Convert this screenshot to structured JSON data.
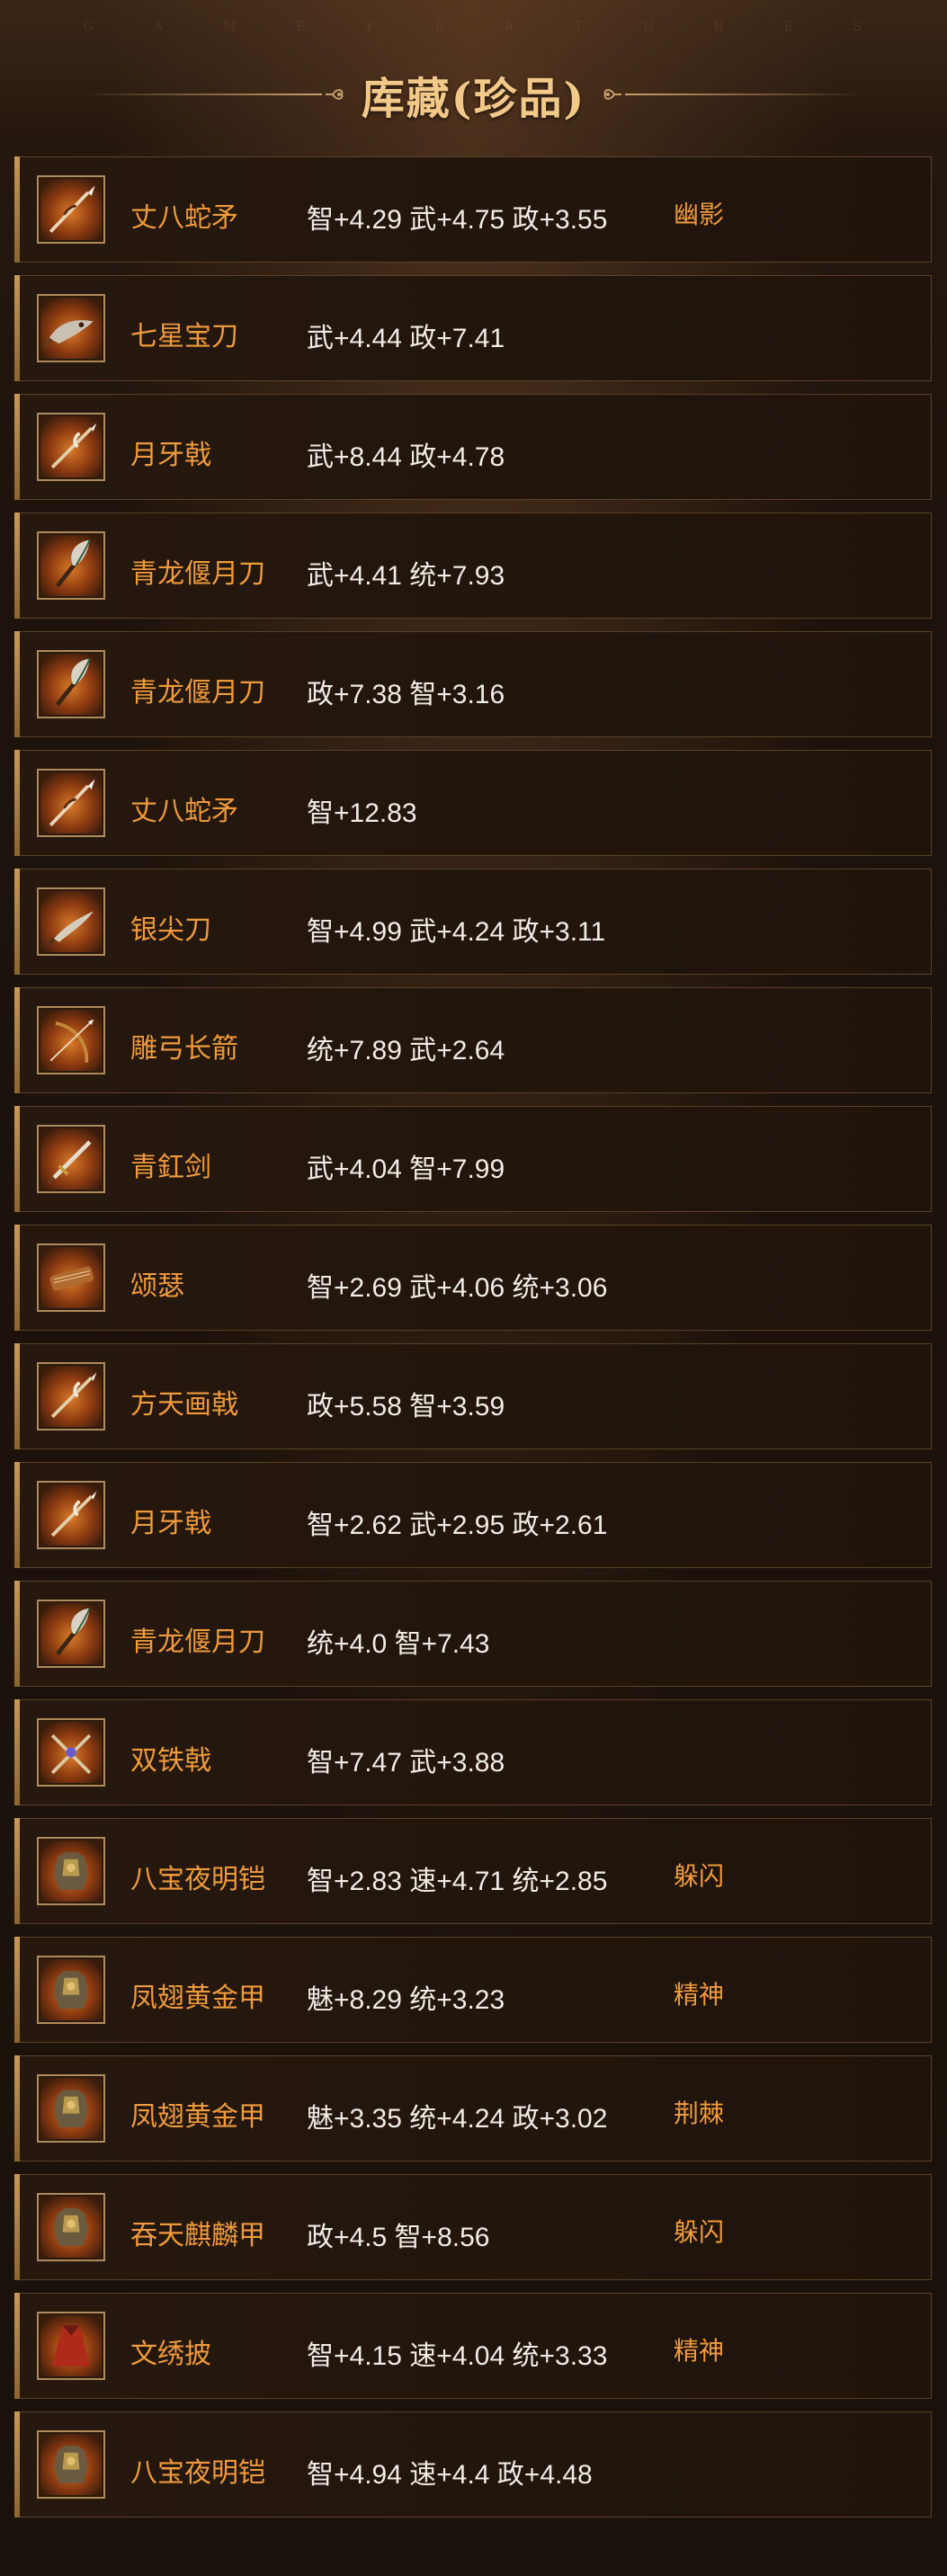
{
  "header": {
    "bg_letters": [
      "G",
      "A",
      "M",
      "E",
      "F",
      "E",
      "A",
      "T",
      "U",
      "R",
      "E",
      "S"
    ],
    "title": "库藏(珍品)"
  },
  "colors": {
    "name": "#ef9a3c",
    "stats": "#f1ece4",
    "title": "#f3c98a",
    "frame": "#b08a5a"
  },
  "items": [
    {
      "name": "丈八蛇矛",
      "stats": "智+4.29 武+4.75 政+3.55",
      "skill": "幽影",
      "icon": "spear-icon"
    },
    {
      "name": "七星宝刀",
      "stats": "武+4.44 政+7.41",
      "skill": "",
      "icon": "dragon-blade-icon"
    },
    {
      "name": "月牙戟",
      "stats": "武+8.44 政+4.78",
      "skill": "",
      "icon": "halberd-icon"
    },
    {
      "name": "青龙偃月刀",
      "stats": "武+4.41 统+7.93",
      "skill": "",
      "icon": "glaive-icon"
    },
    {
      "name": "青龙偃月刀",
      "stats": "政+7.38 智+3.16",
      "skill": "",
      "icon": "glaive-icon"
    },
    {
      "name": "丈八蛇矛",
      "stats": "智+12.83",
      "skill": "",
      "icon": "spear-icon"
    },
    {
      "name": "银尖刀",
      "stats": "智+4.99 武+4.24 政+3.11",
      "skill": "",
      "icon": "blade-icon"
    },
    {
      "name": "雕弓长箭",
      "stats": "统+7.89 武+2.64",
      "skill": "",
      "icon": "bow-icon"
    },
    {
      "name": "青釭剑",
      "stats": "武+4.04 智+7.99",
      "skill": "",
      "icon": "sword-icon"
    },
    {
      "name": "颂瑟",
      "stats": "智+2.69 武+4.06 统+3.06",
      "skill": "",
      "icon": "zither-icon"
    },
    {
      "name": "方天画戟",
      "stats": "政+5.58 智+3.59",
      "skill": "",
      "icon": "halberd-icon"
    },
    {
      "name": "月牙戟",
      "stats": "智+2.62 武+2.95 政+2.61",
      "skill": "",
      "icon": "halberd-icon"
    },
    {
      "name": "青龙偃月刀",
      "stats": "统+4.0 智+7.43",
      "skill": "",
      "icon": "glaive-icon"
    },
    {
      "name": "双铁戟",
      "stats": "智+7.47 武+3.88",
      "skill": "",
      "icon": "twin-halberd-icon"
    },
    {
      "name": "八宝夜明铠",
      "stats": "智+2.83 速+4.71 统+2.85",
      "skill": "躲闪",
      "icon": "armor-icon"
    },
    {
      "name": "凤翅黄金甲",
      "stats": "魅+8.29 统+3.23",
      "skill": "精神",
      "icon": "armor-icon"
    },
    {
      "name": "凤翅黄金甲",
      "stats": "魅+3.35 统+4.24 政+3.02",
      "skill": "荆棘",
      "icon": "armor-icon"
    },
    {
      "name": "吞天麒麟甲",
      "stats": "政+4.5 智+8.56",
      "skill": "躲闪",
      "icon": "armor-icon"
    },
    {
      "name": "文绣披",
      "stats": "智+4.15 速+4.04 统+3.33",
      "skill": "精神",
      "icon": "cloak-icon"
    },
    {
      "name": "八宝夜明铠",
      "stats": "智+4.94 速+4.4 政+4.48",
      "skill": "",
      "icon": "armor-icon"
    }
  ]
}
